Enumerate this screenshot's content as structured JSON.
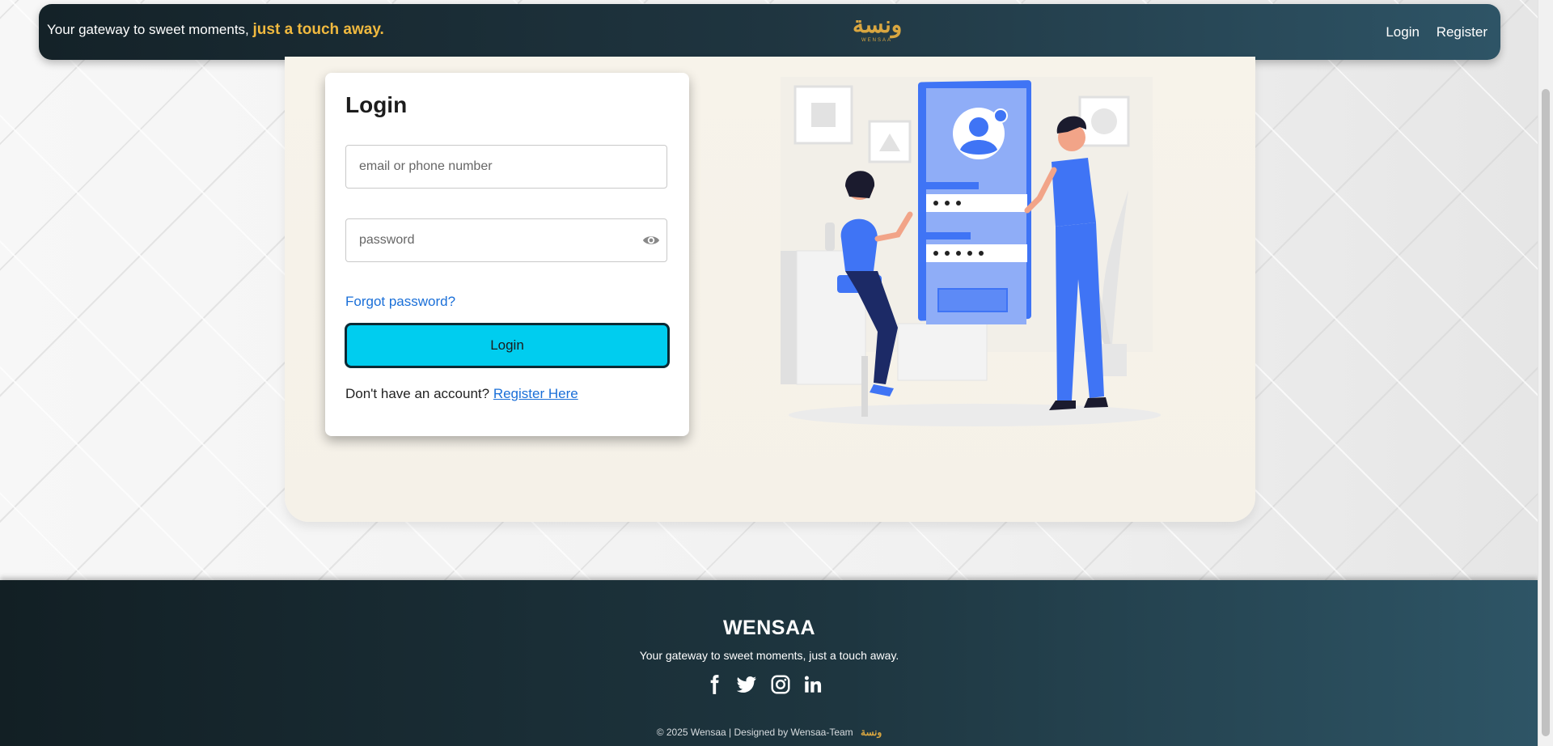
{
  "nav": {
    "tagline_main": "Your gateway to sweet moments,",
    "tagline_accent": "just a touch away.",
    "logo_glyph": "ونسة",
    "logo_word": "WENSAA",
    "login_link": "Login",
    "register_link": "Register"
  },
  "login_card": {
    "title": "Login",
    "email_placeholder": "email or phone number",
    "password_placeholder": "password",
    "forgot_link": "Forgot password?",
    "submit_label": "Login",
    "no_account_text": "Don't have an account?",
    "register_link": "Register Here"
  },
  "footer": {
    "brand": "WENSAA",
    "tagline": "Your gateway to sweet moments, just a touch away.",
    "socials": [
      "facebook-icon",
      "twitter-icon",
      "instagram-icon",
      "linkedin-icon"
    ],
    "copyright": "© 2025 Wensaa | Designed by Wensaa-Team",
    "mini_logo": "ونسة"
  },
  "colors": {
    "accent": "#f0b93f",
    "login_button": "#00cdef",
    "link": "#1a6fd8",
    "nav_dark": "#142228",
    "illustration_blue": "#3f74f5"
  }
}
